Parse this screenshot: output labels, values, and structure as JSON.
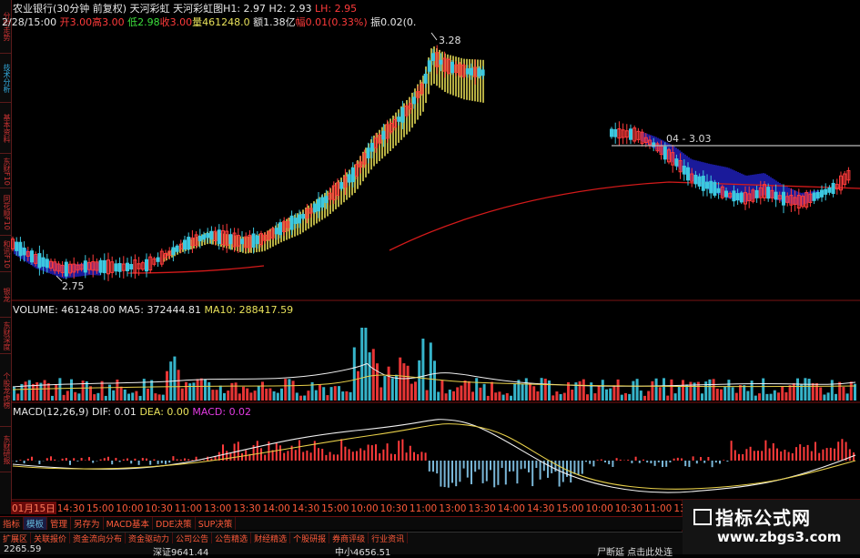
{
  "sidebar": {
    "tabs": [
      {
        "label": "分时走势",
        "color": "red"
      },
      {
        "label": "技术分析",
        "color": "blue"
      },
      {
        "label": "基本资料",
        "color": "red"
      },
      {
        "label": "东财F10",
        "color": "red"
      },
      {
        "label": "同花顺F10",
        "color": "red"
      },
      {
        "label": "和讯F10",
        "color": "red"
      },
      {
        "label": "银龙",
        "color": "red"
      },
      {
        "label": "东财深度",
        "color": "red"
      },
      {
        "label": "个股龙虎榜",
        "color": "red"
      },
      {
        "label": "东财研报",
        "color": "red"
      }
    ]
  },
  "header": {
    "line1": {
      "stock": "农业银行(30分钟 前复权)",
      "indicator1": "天河彩虹",
      "indicator2": "天河彩虹图",
      "h1": "H1: 2.97",
      "h2": "H2: 2.93",
      "lh": "LH: 2.95"
    },
    "line2": {
      "time": "2/28/15:00",
      "open": "开3.00",
      "high": "高3.00",
      "low": "低2.98",
      "close": "收3.00",
      "volume": "量461248.0",
      "amount": "额1.38亿",
      "change": "幅0.01(0.33%)",
      "amplitude": "振0.02(0."
    }
  },
  "price_chart": {
    "high_label": "3.28",
    "low_label": "2.75",
    "level_label": "04 - 3.03"
  },
  "volume_panel": {
    "label": "VOLUME: 461248.00",
    "ma5": "MA5: 372444.81",
    "ma10": "MA10: 288417.59"
  },
  "macd_panel": {
    "label": "MACD(12,26,9)",
    "dif": "DIF: 0.01",
    "dea": "DEA: 0.00",
    "macd": "MACD: 0.02"
  },
  "time_axis": [
    "01月15日",
    "14:30",
    "15:00",
    "10:00",
    "10:30",
    "11:00",
    "13:00",
    "13:30",
    "14:00",
    "14:30",
    "15:00",
    "10:00",
    "10:30",
    "11:00",
    "13:00",
    "13:30",
    "14:00",
    "14:30",
    "15:00",
    "10:00",
    "10:30",
    "11:00",
    "13:00",
    "13:30",
    "14:00",
    "14:30",
    "15"
  ],
  "bottom_tabs": {
    "row1": [
      "指标",
      "模板",
      "管理",
      "另存为",
      "MACD基本",
      "DDE决策",
      "SUP决策"
    ],
    "row2": [
      "扩展区",
      "关联报价",
      "资金流向分布",
      "资金驱动力",
      "公司公告",
      "公告精选",
      "财经精选",
      "个股研报",
      "券商评级",
      "行业资讯"
    ]
  },
  "status": {
    "index1": "2265.59",
    "index2": "深证9641.44",
    "index3": "中小4656.51",
    "link": "尸断延 点击此处连"
  },
  "watermark": {
    "title": "指标公式网",
    "url": "www.zbgs3.com"
  },
  "colors": {
    "up": "#ff3b3b",
    "down": "#3cc8e0",
    "rainbow_fill": "#c8c04a",
    "cloud_fill": "#1a1a9a",
    "ma_line": "#d41a1a",
    "dif_line": "#f0f0f0",
    "dea_line": "#e8d04a"
  }
}
